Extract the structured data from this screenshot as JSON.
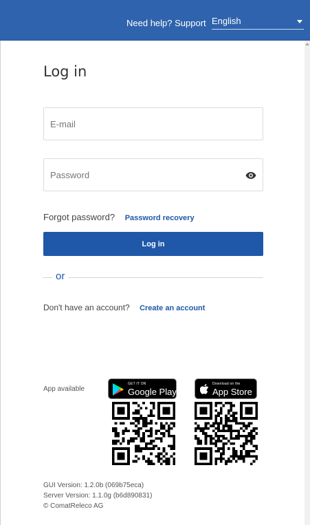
{
  "header": {
    "help_link": "Need help? Support",
    "language": "English"
  },
  "login": {
    "title": "Log in",
    "email_placeholder": "E-mail",
    "password_placeholder": "Password",
    "forgot_text": "Forgot password?",
    "recovery_link": "Password recovery",
    "submit_label": "Log in",
    "or_label": "or",
    "no_account_text": "Don't have an account?",
    "create_account_link": "Create an account"
  },
  "apps": {
    "label": "App available",
    "google_play": {
      "small_text": "GET IT ON",
      "name": "Google Play"
    },
    "app_store": {
      "small_text": "Download on the",
      "name": "App Store"
    }
  },
  "footer": {
    "gui_version": "GUI Version: 1.2.0b (069b75eca)",
    "server_version": "Server Version: 1.1.0g (b6d890831)",
    "copyright": "© ComatReleco AG"
  },
  "colors": {
    "header_bg": "#2f63ad",
    "accent": "#1f58a8"
  },
  "icons": [
    "eye-icon",
    "google-play-icon",
    "apple-icon",
    "caret-down-icon"
  ]
}
